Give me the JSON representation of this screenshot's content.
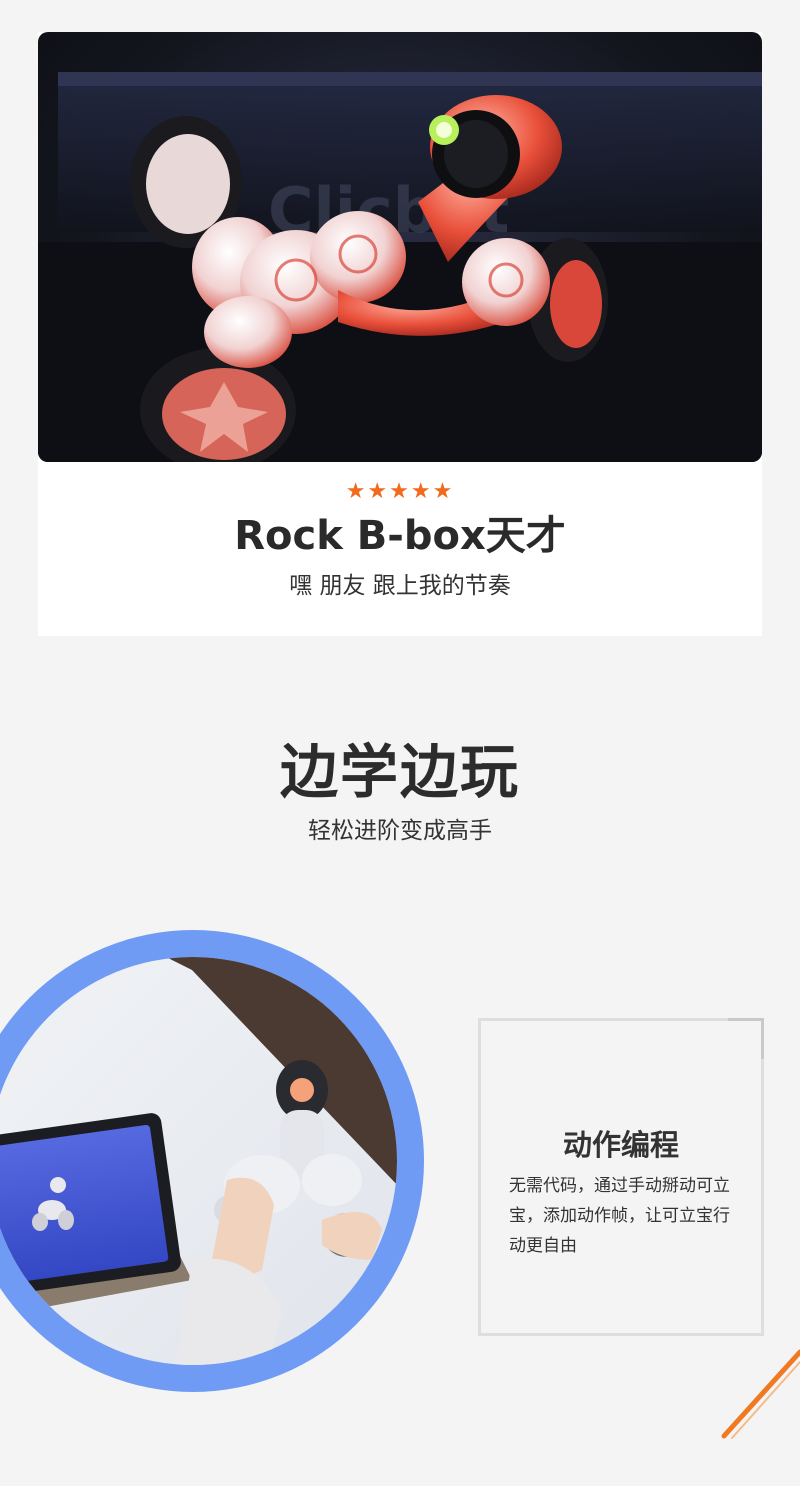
{
  "product": {
    "rating": "★★★★★",
    "title": "Rock B-box天才",
    "subtitle": "嘿 朋友 跟上我的节奏"
  },
  "section": {
    "title": "边学边玩",
    "subtitle": "轻松进阶变成高手"
  },
  "feature": {
    "title": "动作编程",
    "description": "无需代码，通过手动掰动可立宝，添加动作帧，让可立宝行动更自由"
  },
  "colors": {
    "accent": "#f06b1f",
    "ring": "#6f9bf5",
    "page_bg": "#f4f4f4"
  },
  "icons": {
    "rating": "star-icon"
  }
}
